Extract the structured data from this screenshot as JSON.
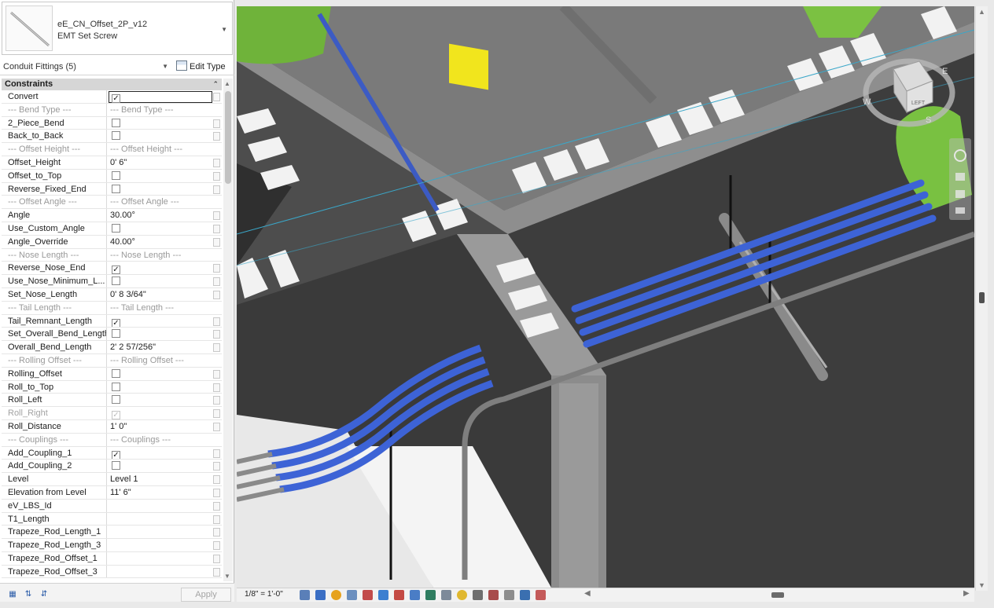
{
  "type_selector": {
    "family": "eE_CN_Offset_2P_v12",
    "type": "EMT Set Screw"
  },
  "filter": {
    "label": "Conduit Fittings (5)",
    "edit_type": "Edit Type"
  },
  "group": {
    "label": "Constraints"
  },
  "rows": [
    {
      "name": "Convert",
      "value": "",
      "check": true,
      "active": true
    },
    {
      "name": "--- Bend Type ---",
      "value": "--- Bend Type ---",
      "section": true
    },
    {
      "name": "2_Piece_Bend",
      "value": "",
      "check": false
    },
    {
      "name": "Back_to_Back",
      "value": "",
      "check": false
    },
    {
      "name": "--- Offset Height ---",
      "value": "--- Offset Height ---",
      "section": true
    },
    {
      "name": "Offset_Height",
      "value": "0'  6\""
    },
    {
      "name": "Offset_to_Top",
      "value": "",
      "check": false
    },
    {
      "name": "Reverse_Fixed_End",
      "value": "",
      "check": false
    },
    {
      "name": "--- Offset Angle ---",
      "value": "--- Offset Angle ---",
      "section": true
    },
    {
      "name": "Angle",
      "value": "30.00°"
    },
    {
      "name": "Use_Custom_Angle",
      "value": "",
      "check": false
    },
    {
      "name": "Angle_Override",
      "value": "40.00°"
    },
    {
      "name": "--- Nose Length ---",
      "value": "--- Nose Length ---",
      "section": true
    },
    {
      "name": "Reverse_Nose_End",
      "value": "",
      "check": true
    },
    {
      "name": "Use_Nose_Minimum_L...",
      "value": "",
      "check": false
    },
    {
      "name": "Set_Nose_Length",
      "value": "0'  8 3/64\""
    },
    {
      "name": "--- Tail Length ---",
      "value": "--- Tail Length ---",
      "section": true
    },
    {
      "name": "Tail_Remnant_Length",
      "value": "",
      "check": true
    },
    {
      "name": "Set_Overall_Bend_Length",
      "value": "",
      "check": false
    },
    {
      "name": "Overall_Bend_Length",
      "value": "2'  2 57/256\""
    },
    {
      "name": "--- Rolling Offset ---",
      "value": "--- Rolling Offset ---",
      "section": true
    },
    {
      "name": "Rolling_Offset",
      "value": "",
      "check": false
    },
    {
      "name": "Roll_to_Top",
      "value": "",
      "check": false
    },
    {
      "name": "Roll_Left",
      "value": "",
      "check": false
    },
    {
      "name": "Roll_Right",
      "value": "",
      "check": true,
      "disabled": true
    },
    {
      "name": "Roll_Distance",
      "value": "1'  0\""
    },
    {
      "name": "--- Couplings ---",
      "value": "--- Couplings ---",
      "section": true
    },
    {
      "name": "Add_Coupling_1",
      "value": "",
      "check": true
    },
    {
      "name": "Add_Coupling_2",
      "value": "",
      "check": false
    },
    {
      "name": "Level",
      "value": "Level 1"
    },
    {
      "name": "Elevation from Level",
      "value": "11'  6\""
    },
    {
      "name": "eV_LBS_Id",
      "value": ""
    },
    {
      "name": "T1_Length",
      "value": ""
    },
    {
      "name": "Trapeze_Rod_Length_1",
      "value": ""
    },
    {
      "name": "Trapeze_Rod_Length_3",
      "value": ""
    },
    {
      "name": "Trapeze_Rod_Offset_1",
      "value": ""
    },
    {
      "name": "Trapeze_Rod_Offset_3",
      "value": ""
    }
  ],
  "footer": {
    "apply": "Apply"
  },
  "viewport": {
    "scale": "1/8\" = 1'-0\"",
    "colors": {
      "conduit": "#3d63d6",
      "duct": "#7bc142",
      "wall": "#3f3f3f",
      "floor": "#7d7d7d"
    },
    "viewcube": {
      "face": "LEFT",
      "compass": [
        "W",
        "S",
        "E"
      ]
    }
  }
}
